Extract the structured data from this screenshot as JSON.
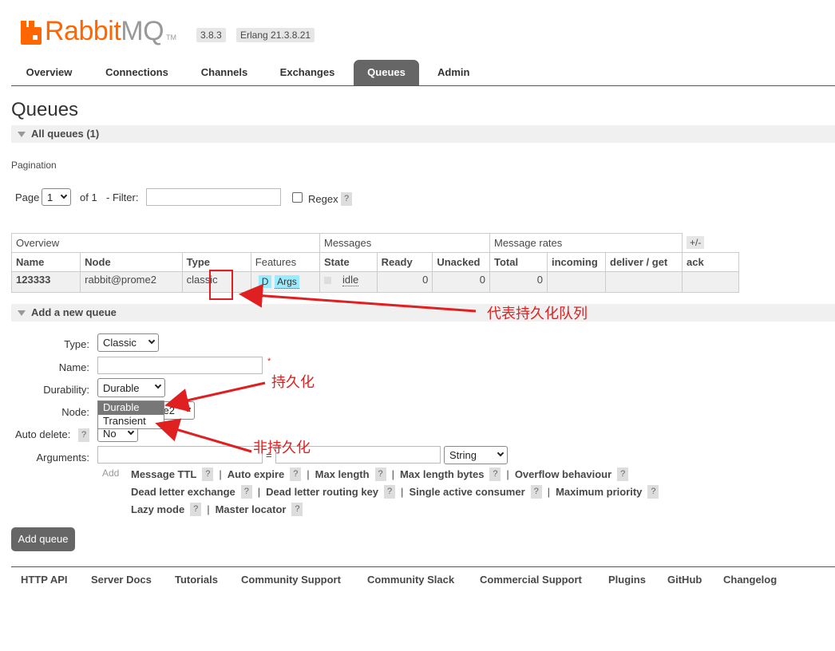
{
  "header": {
    "logo_rabbit": "Rabbit",
    "logo_mq": "MQ",
    "logo_tm": "TM",
    "version": "3.8.3",
    "erlang": "Erlang 21.3.8.21"
  },
  "tabs": [
    "Overview",
    "Connections",
    "Channels",
    "Exchanges",
    "Queues",
    "Admin"
  ],
  "active_tab": "Queues",
  "page_title": "Queues",
  "all_queues_header": "All queues (1)",
  "pagination": {
    "label": "Pagination",
    "page_label": "Page",
    "page_value": "1",
    "of_label": "of 1",
    "filter_label": "- Filter:",
    "filter_value": "",
    "regex_label": "Regex",
    "help": "?"
  },
  "table": {
    "groups": [
      "Overview",
      "Messages",
      "Message rates"
    ],
    "plus_minus": "+/-",
    "columns": [
      "Name",
      "Node",
      "Type",
      "Features",
      "State",
      "Ready",
      "Unacked",
      "Total",
      "incoming",
      "deliver / get",
      "ack"
    ],
    "rows": [
      {
        "name": "123333",
        "node": "rabbit@prome2",
        "type": "classic",
        "feature_d": "D",
        "feature_args": "Args",
        "state": "idle",
        "ready": "0",
        "unacked": "0",
        "total": "0",
        "incoming": "",
        "deliver_get": "",
        "ack": ""
      }
    ]
  },
  "add_queue": {
    "header": "Add a new queue",
    "type_label": "Type:",
    "type_value": "Classic",
    "name_label": "Name:",
    "name_value": "",
    "required_mark": "*",
    "durability_label": "Durability:",
    "durability_value": "Durable",
    "durability_options": [
      "Durable",
      "Transient"
    ],
    "node_label": "Node:",
    "node_value_visible": "e2",
    "auto_delete_label": "Auto delete:",
    "auto_delete_help": "?",
    "auto_delete_value": "No",
    "arguments_label": "Arguments:",
    "arguments_eq": "=",
    "arguments_type": "String",
    "add_label": "Add",
    "options_row1": [
      "Message TTL",
      "Auto expire",
      "Max length",
      "Max length bytes",
      "Overflow behaviour"
    ],
    "options_row2": [
      "Dead letter exchange",
      "Dead letter routing key",
      "Single active consumer",
      "Maximum priority"
    ],
    "options_row3": [
      "Lazy mode",
      "Master locator"
    ],
    "separator": "|",
    "help": "?",
    "button": "Add queue"
  },
  "footer": [
    "HTTP API",
    "Server Docs",
    "Tutorials",
    "Community Support",
    "Community Slack",
    "Commercial Support",
    "Plugins",
    "GitHub",
    "Changelog"
  ],
  "annotations": {
    "durable_queue": "代表持久化队列",
    "durable": "持久化",
    "transient": "非持久化"
  },
  "colors": {
    "brand_orange": "#ff6600",
    "active_tab": "#666666",
    "feature_badge": "#99ebff",
    "annotation_red": "#e02020"
  }
}
